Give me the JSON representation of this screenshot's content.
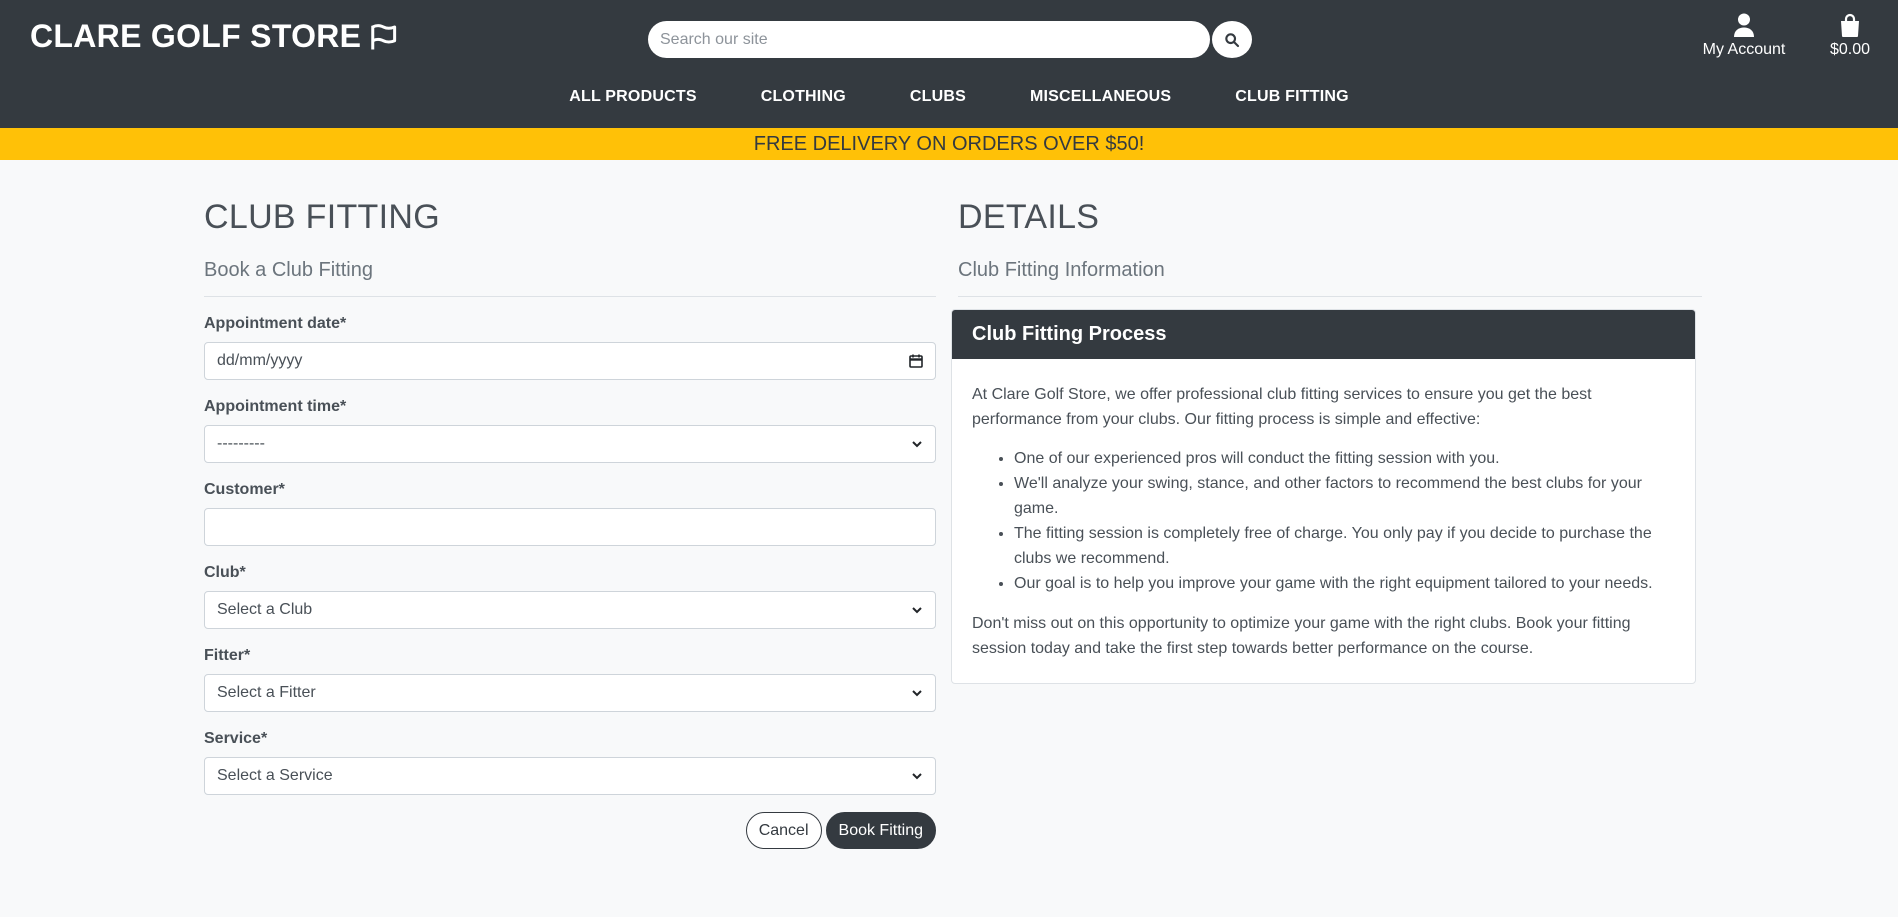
{
  "header": {
    "logo_text": "CLARE GOLF STORE",
    "search_placeholder": "Search our site",
    "account_label": "My Account",
    "cart_total": "$0.00"
  },
  "nav": {
    "items": [
      {
        "label": "ALL PRODUCTS"
      },
      {
        "label": "CLOTHING"
      },
      {
        "label": "CLUBS"
      },
      {
        "label": "MISCELLANEOUS"
      },
      {
        "label": "CLUB FITTING"
      }
    ]
  },
  "promo": {
    "text": "FREE DELIVERY ON ORDERS OVER $50!"
  },
  "form": {
    "title": "CLUB FITTING",
    "subtitle": "Book a Club Fitting",
    "date": {
      "label": "Appointment date*",
      "value": "dd/mm/yyyy"
    },
    "time": {
      "label": "Appointment time*",
      "value": "---------"
    },
    "customer": {
      "label": "Customer*",
      "value": ""
    },
    "club": {
      "label": "Club*",
      "value": "Select a Club"
    },
    "fitter": {
      "label": "Fitter*",
      "value": "Select a Fitter"
    },
    "service": {
      "label": "Service*",
      "value": "Select a Service"
    },
    "cancel_label": "Cancel",
    "submit_label": "Book Fitting"
  },
  "details": {
    "title": "DETAILS",
    "subtitle": "Club Fitting Information",
    "card_title": "Club Fitting Process",
    "intro": "At Clare Golf Store, we offer professional club fitting services to ensure you get the best performance from your clubs. Our fitting process is simple and effective:",
    "points": [
      "One of our experienced pros will conduct the fitting session with you.",
      "We'll analyze your swing, stance, and other factors to recommend the best clubs for your game.",
      "The fitting session is completely free of charge. You only pay if you decide to purchase the clubs we recommend.",
      "Our goal is to help you improve your game with the right equipment tailored to your needs."
    ],
    "outro": "Don't miss out on this opportunity to optimize your game with the right clubs. Book your fitting session today and take the first step towards better performance on the course."
  },
  "colors": {
    "header_bg": "#343a40",
    "promo_bg": "#ffc107",
    "page_bg": "#f8f9fa"
  },
  "icons": [
    "flag-icon",
    "search-icon",
    "user-icon",
    "shopping-bag-icon",
    "calendar-icon",
    "chevron-down-icon"
  ]
}
